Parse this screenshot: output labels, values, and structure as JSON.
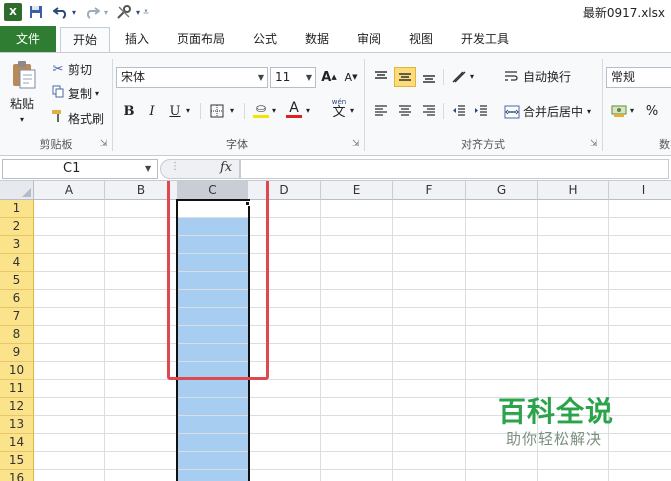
{
  "window": {
    "title": "最新0917.xlsx"
  },
  "quick_access": {
    "save_icon": "save-icon",
    "undo_icon": "undo-icon",
    "redo_icon": "redo-icon",
    "customize_icon": "customize-icon"
  },
  "tabs": [
    {
      "label": "文件"
    },
    {
      "label": "开始"
    },
    {
      "label": "插入"
    },
    {
      "label": "页面布局"
    },
    {
      "label": "公式"
    },
    {
      "label": "数据"
    },
    {
      "label": "审阅"
    },
    {
      "label": "视图"
    },
    {
      "label": "开发工具"
    }
  ],
  "ribbon": {
    "clipboard": {
      "paste_label": "粘贴",
      "cut_label": "剪切",
      "copy_label": "复制",
      "format_painter_label": "格式刷",
      "group_label": "剪贴板"
    },
    "font": {
      "font_name": "宋体",
      "font_size": "11",
      "bold": "B",
      "italic": "I",
      "underline": "U",
      "grow": "A",
      "shrink": "A",
      "font_color_glyph": "A",
      "phonetic_glyph": "文",
      "group_label": "字体",
      "font_color": "#e02020",
      "fill_color": "#f2e600"
    },
    "alignment": {
      "wrap_label": "自动换行",
      "merge_label": "合并后居中",
      "group_label": "对齐方式"
    },
    "number": {
      "format_value": "常规",
      "percent": "%",
      "group_label": "数字"
    }
  },
  "formula_bar": {
    "name_box_value": "C1",
    "fx_label": "fx",
    "formula_value": ""
  },
  "sheet": {
    "columns": [
      "A",
      "B",
      "C",
      "D",
      "E",
      "F",
      "G",
      "H",
      "I"
    ],
    "rows": [
      "1",
      "2",
      "3",
      "4",
      "5",
      "6",
      "7",
      "8",
      "9",
      "10",
      "11",
      "12",
      "13",
      "14",
      "15",
      "16"
    ],
    "selected_column": "C",
    "selection_color": "#a7cdf0",
    "highlight_color": "#e0484f"
  },
  "watermark": {
    "title": "百科全说",
    "subtitle": "助你轻松解决"
  }
}
